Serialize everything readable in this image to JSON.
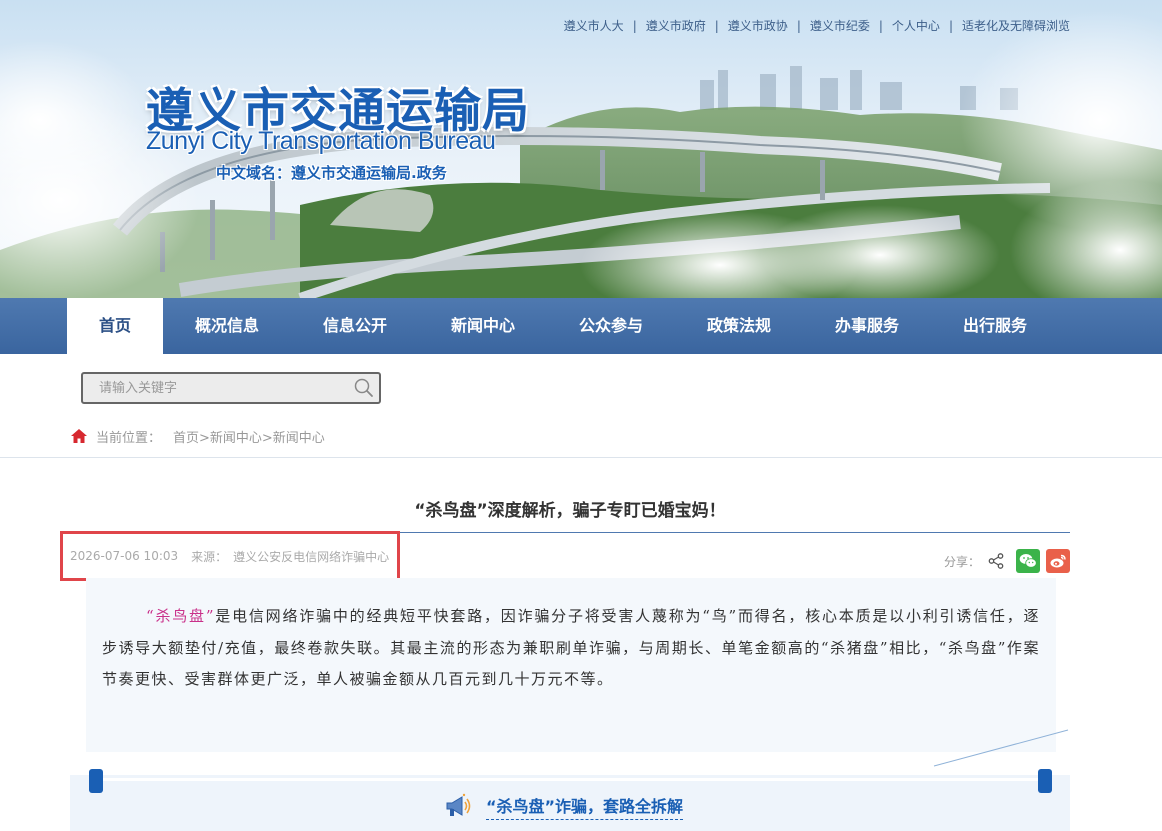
{
  "header": {
    "top_links": [
      "遵义市人大",
      "遵义市政府",
      "遵义市政协",
      "遵义市纪委",
      "个人中心",
      "适老化及无障碍浏览"
    ],
    "separator": "|",
    "title_cn": "遵义市交通运输局",
    "title_en": "Zunyi City Transportation Bureau",
    "domain_label": "中文域名：遵义市交通运输局.政务"
  },
  "nav": {
    "items": [
      "首页",
      "概况信息",
      "信息公开",
      "新闻中心",
      "公众参与",
      "政策法规",
      "办事服务",
      "出行服务"
    ],
    "active_index": 0
  },
  "search": {
    "placeholder": "请输入关键字",
    "value": ""
  },
  "breadcrumb": {
    "label": "当前位置：",
    "path": "首页>新闻中心>新闻中心"
  },
  "article": {
    "title": "“杀鸟盘”深度解析，骗子专盯已婚宝妈！",
    "date": "2026-07-06 10:03",
    "source_label": "来源：",
    "source": "遵义公安反电信网络诈骗中心",
    "share_label": "分享：",
    "intro_highlight": "“杀鸟盘”",
    "intro_text": "是电信网络诈骗中的经典短平快套路，因诈骗分子将受害人蔑称为“鸟”而得名，核心本质是以小利引诱信任，逐步诱导大额垫付/充值，最终卷款失联。其最主流的形态为兼职刷单诈骗，与周期长、单笔金额高的“杀猪盘”相比，“杀鸟盘”作案节奏更快、受害群体更广泛，单人被骗金额从几百元到几十万元不等。",
    "section_heading": "“杀鸟盘”诈骗，套路全拆解"
  },
  "colors": {
    "nav_bg": "#3a659f",
    "brand_blue": "#1a5fb4",
    "highlight": "#c9318a",
    "meta_box_border": "#e0454a",
    "wechat": "#3bb34a",
    "weibo": "#e9604a"
  },
  "icons": [
    "search-icon",
    "home-icon",
    "share-icon",
    "wechat-icon",
    "weibo-icon",
    "megaphone-icon"
  ]
}
